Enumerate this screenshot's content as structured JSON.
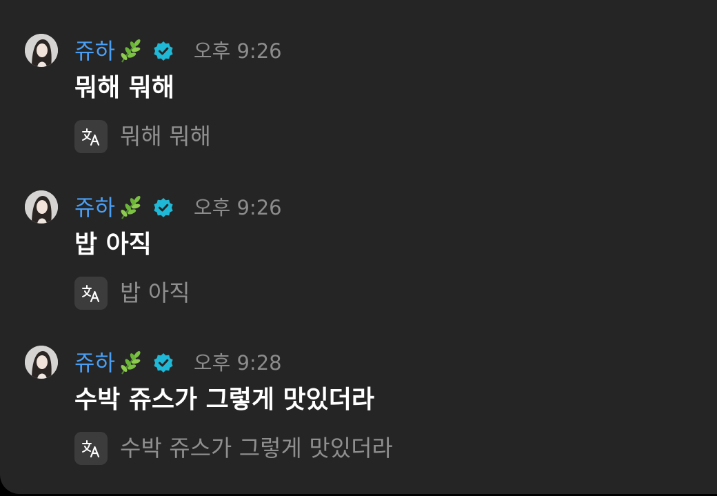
{
  "messages": [
    {
      "username": "쥬하",
      "badge_emoji_icon": "herb-leaf-icon",
      "verified_icon": "verified-badge-icon",
      "time": "오후 9:26",
      "text": "뭐해 뭐해",
      "translated_text": "뭐해 뭐해"
    },
    {
      "username": "쥬하",
      "badge_emoji_icon": "herb-leaf-icon",
      "verified_icon": "verified-badge-icon",
      "time": "오후 9:26",
      "text": "밥 아직",
      "translated_text": "밥 아직"
    },
    {
      "username": "쥬하",
      "badge_emoji_icon": "herb-leaf-icon",
      "verified_icon": "verified-badge-icon",
      "time": "오후 9:28",
      "text": "수박 쥬스가 그렇게 맛있더라",
      "translated_text": "수박 쥬스가 그렇게 맛있더라"
    }
  ],
  "colors": {
    "background": "#252525",
    "username": "#4a9ff5",
    "verified": "#1fb8d6",
    "timestamp": "#8c8c8c",
    "message_text": "#ffffff",
    "translated_text": "#8f8f8f"
  }
}
